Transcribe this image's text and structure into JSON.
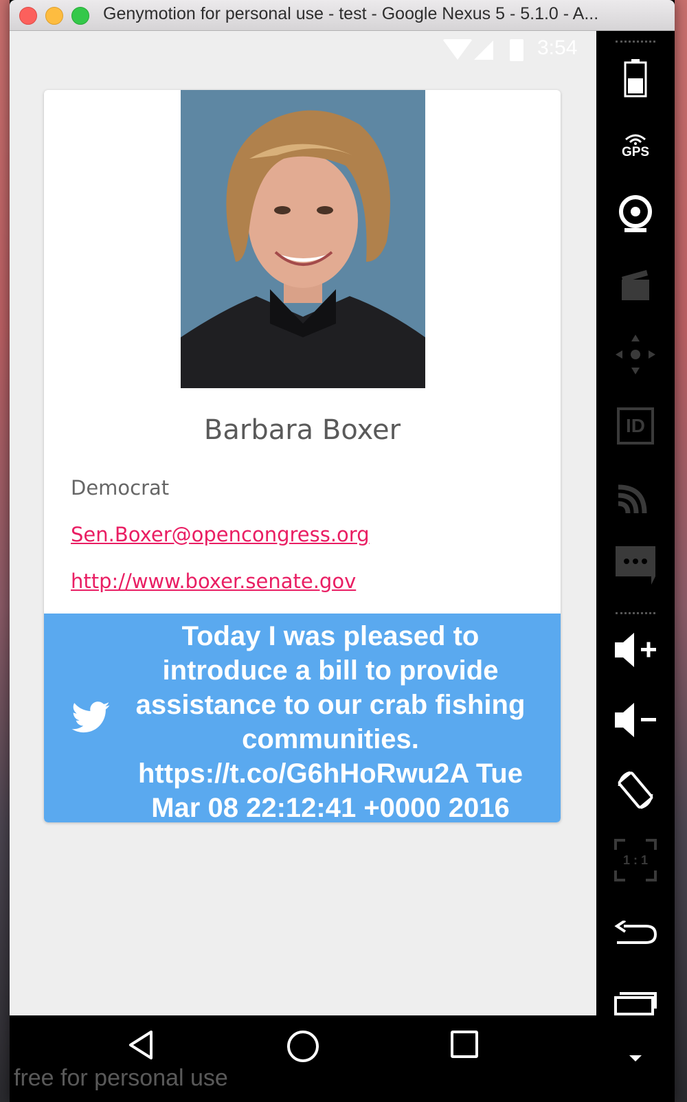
{
  "window": {
    "title": "Genymotion for personal use - test - Google Nexus 5 - 5.1.0 - A..."
  },
  "status_bar": {
    "time": "3:54"
  },
  "card": {
    "name": "Barbara Boxer",
    "party": "Democrat",
    "email": "Sen.Boxer@opencongress.org",
    "website": "http://www.boxer.senate.gov",
    "photo_icon": "portrait-photo"
  },
  "tweet": {
    "icon": "twitter-bird-icon",
    "text": "Today I was pleased to introduce a bill to provide assistance to our crab fishing communities. https://t.co/G6hHoRwu2A Tue Mar 08 22:12:41 +0000 2016",
    "background_color": "#5aa9ef"
  },
  "nav_bar": {
    "icons": [
      "back-icon",
      "home-icon",
      "recent-apps-icon"
    ]
  },
  "watermark": "free for personal use",
  "toolbar": {
    "gps_label": "GPS",
    "id_label": "ID",
    "ratio_label": "1 : 1",
    "items": [
      "battery-icon",
      "gps-icon",
      "webcam-icon",
      "capture-icon",
      "dpad-icon",
      "device-id-icon",
      "cast-icon",
      "sms-icon",
      "volume-up-icon",
      "volume-down-icon",
      "rotate-icon",
      "pixel-ratio-icon",
      "back-icon",
      "recent-apps-icon",
      "menu-icon"
    ]
  },
  "colors": {
    "link": "#e91e63",
    "tweet_bg": "#5aa9ef",
    "screen_bg": "#eeeeee"
  }
}
